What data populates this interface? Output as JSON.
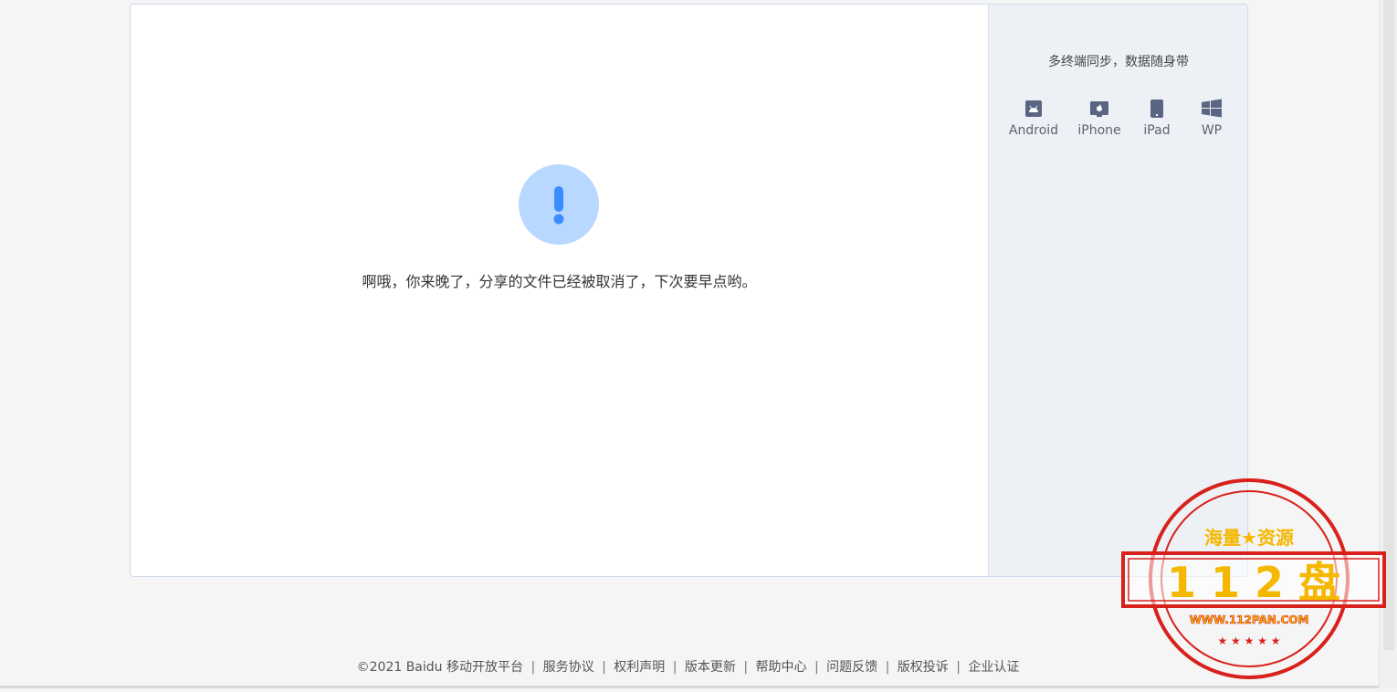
{
  "sidebar": {
    "title": "多终端同步，数据随身带",
    "platforms": [
      {
        "label": "Android",
        "icon": "android-icon"
      },
      {
        "label": "iPhone",
        "icon": "iphone-icon"
      },
      {
        "label": "iPad",
        "icon": "ipad-icon"
      },
      {
        "label": "WP",
        "icon": "windows-icon"
      }
    ]
  },
  "main": {
    "message": "啊哦，你来晚了，分享的文件已经被取消了，下次要早点哟。"
  },
  "footer": {
    "copyright": "©2021 Baidu",
    "links": [
      "移动开放平台",
      "服务协议",
      "权利声明",
      "版本更新",
      "帮助中心",
      "问题反馈",
      "版权投诉",
      "企业认证"
    ]
  },
  "watermark": {
    "top_text": "海量★资源",
    "main_text": "1 1 2 盘",
    "url": "WWW.112PAN.COM"
  },
  "colors": {
    "accent": "#3b8cff",
    "warn_bg": "#b9d8ff",
    "icon": "#5a6583",
    "stamp_red": "#d9211c",
    "stamp_yellow": "#f5b800"
  }
}
